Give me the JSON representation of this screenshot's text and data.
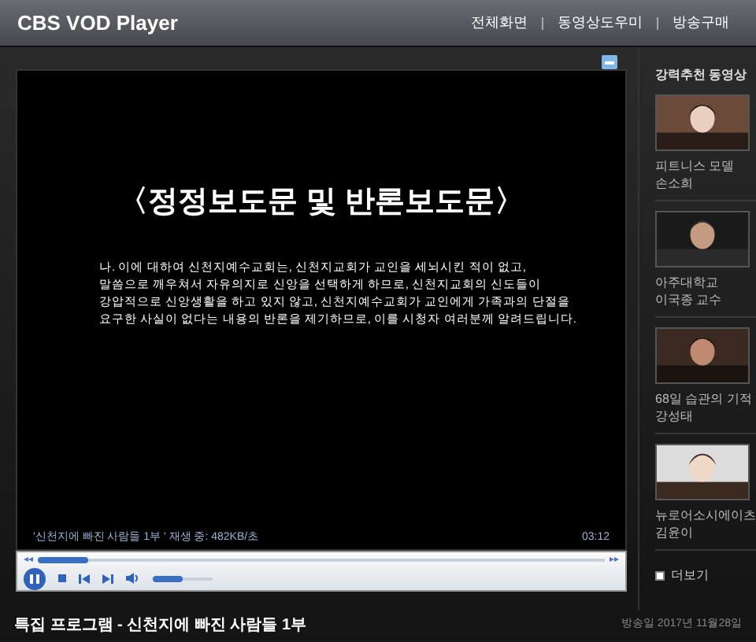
{
  "header": {
    "title": "CBS VOD Player",
    "links": [
      "전체화면",
      "동영상도우미",
      "방송구매"
    ]
  },
  "video": {
    "heading": "〈정정보도문 및 반론보도문〉",
    "body": "나. 이에 대하여 신천지예수교회는, 신천지교회가 교인을 세뇌시킨 적이 없고,\n말씀으로 깨우쳐서 자유의지로 신앙을 선택하게 하므로, 신천지교회의 신도들이\n강압적으로 신앙생활을 하고 있지 않고, 신천지예수교회가 교인에게 가족과의 단절을\n요구한 사실이 없다는 내용의 반론을 제기하므로, 이를 시청자 여러분께 알려드립니다.",
    "status": "'신천지에 빠진 사람들 1부 ' 재생 중: 482KB/초",
    "time": "03:12"
  },
  "controls": {
    "playing": true,
    "seek": {
      "level": 0.09
    },
    "volume": {
      "level": 0.5
    }
  },
  "sidebar": {
    "title": "강력추천 동영상",
    "items": [
      {
        "line1": "피트니스 모델",
        "line2": "손소희",
        "kind": "picture"
      },
      {
        "line1": "아주대학교",
        "line2": "이국종 교수",
        "kind": "picture"
      },
      {
        "line1": "68일 습관의 기적",
        "line2": "강성태",
        "kind": "picture"
      },
      {
        "line1": "뉴로어소시에이츠",
        "line2": "김윤이",
        "kind": "picture"
      }
    ],
    "more": "더보기"
  },
  "footer": {
    "title": "특집 프로그램 - 신천지에 빠진 사람들 1부",
    "date": "방송일 2017년 11월28일"
  }
}
